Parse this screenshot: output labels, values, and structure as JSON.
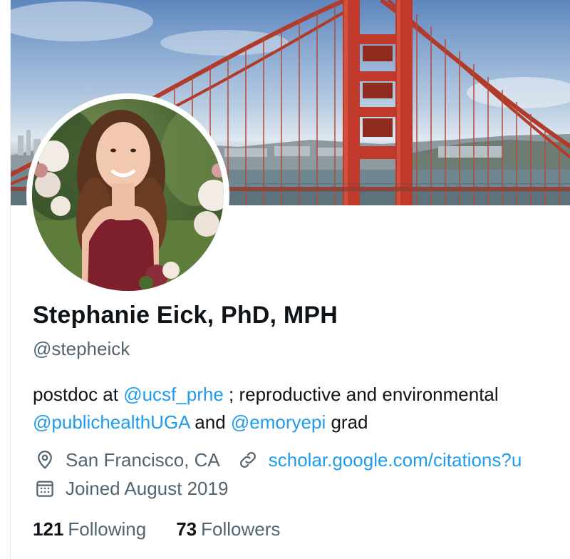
{
  "profile": {
    "display_name": "Stephanie Eick, PhD, MPH",
    "handle": "@stepheick",
    "bio": {
      "line1_prefix": "postdoc at ",
      "line1_mention": "@ucsf_prhe",
      "line1_suffix": " ; reproductive and environmental",
      "line2_mention1": "@publichealthUGA",
      "line2_middle": " and ",
      "line2_mention2": "@emoryepi",
      "line2_suffix": " grad"
    },
    "location": "San Francisco, CA",
    "website": "scholar.google.com/citations?u",
    "joined": "Joined August 2019",
    "following": {
      "count": "121",
      "label": "Following"
    },
    "followers": {
      "count": "73",
      "label": "Followers"
    }
  },
  "icons": {
    "location": "location-pin-icon",
    "link": "link-icon",
    "calendar": "calendar-icon"
  },
  "colors": {
    "link": "#1d9bf0",
    "secondary_text": "#536471",
    "bridge": "#c0392b"
  }
}
